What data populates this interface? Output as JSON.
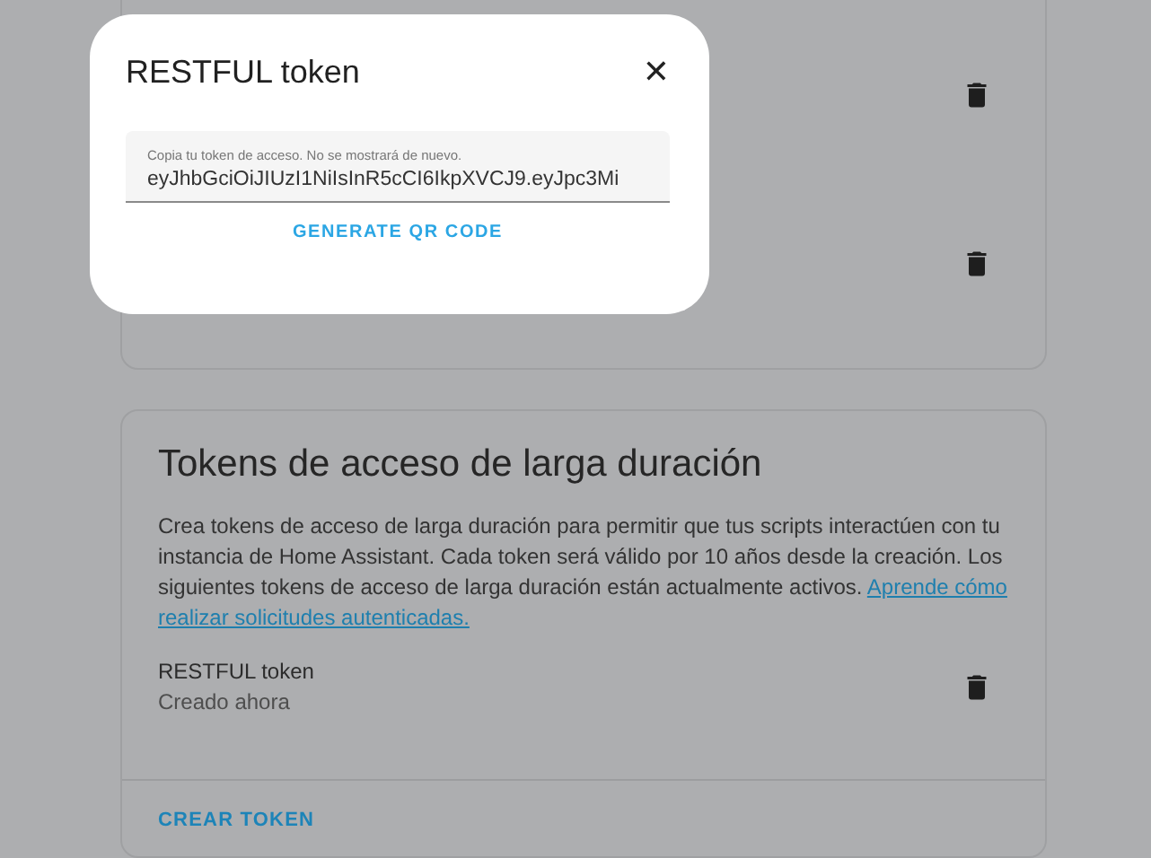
{
  "dialog": {
    "title": "RESTFUL token",
    "close": "✕",
    "field": {
      "label": "Copia tu token de acceso. No se mostrará de nuevo.",
      "value": "eyJhbGciOiJIUzI1NiIsInR5cCI6IkpXVCJ9.eyJpc3Mi"
    },
    "action": "GENERATE QR CODE"
  },
  "card": {
    "title": "Tokens de acceso de larga duración",
    "description": "Crea tokens de acceso de larga duración para permitir que tus scripts interactúen con tu instancia de Home Assistant. Cada token será válido por 10 años desde la creación. Los siguientes tokens de acceso de larga duración están actualmente activos.",
    "link": [
      "Aprende cómo",
      "realizar solicitudes autenticadas."
    ],
    "tokens": [
      {
        "name": "RESTFUL token",
        "created": "Creado ahora"
      }
    ],
    "action": "CREAR TOKEN"
  }
}
